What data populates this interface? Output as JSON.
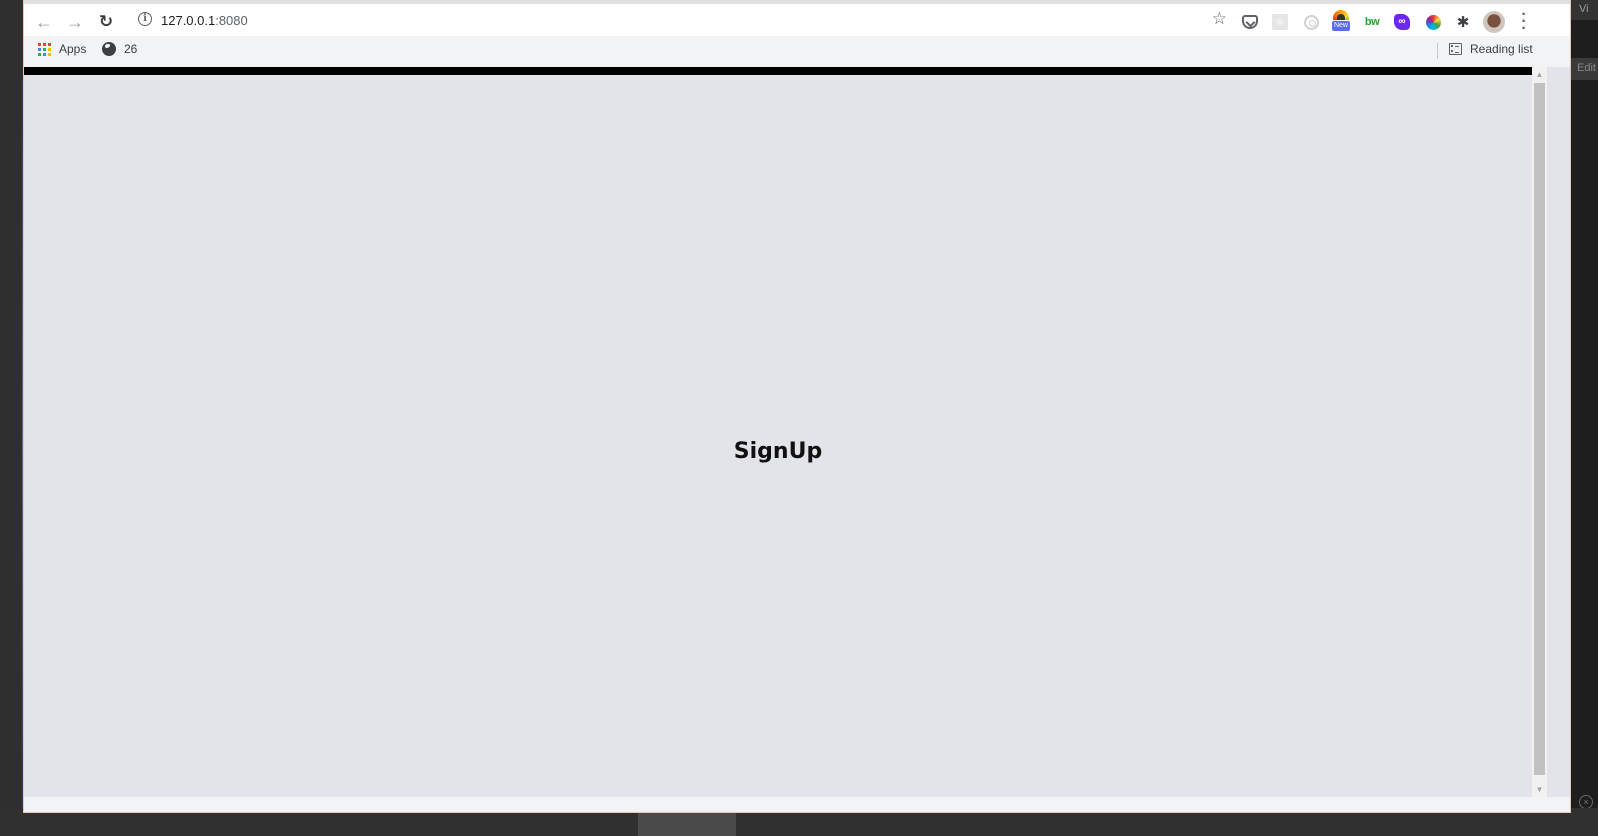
{
  "browser": {
    "url_host": "127.0.0.1",
    "url_port": ":8080",
    "icons": {
      "back": "←",
      "forward": "→",
      "reload": "↻",
      "info": "i",
      "star": "☆",
      "puzzle": "✱",
      "menu": "⋮"
    },
    "extensions": [
      {
        "name": "pocket"
      },
      {
        "name": "react-devtools"
      },
      {
        "name": "target"
      },
      {
        "name": "rainbow",
        "badge": "New"
      },
      {
        "name": "bw",
        "label": "bw"
      },
      {
        "name": "link",
        "label": "∞"
      },
      {
        "name": "color-wheel"
      },
      {
        "name": "extensions-puzzle"
      }
    ]
  },
  "bookmarks": {
    "apps_label": "Apps",
    "apps_colors": [
      "#ea4335",
      "#ea4335",
      "#ea4335",
      "#4285f4",
      "#34a853",
      "#fbbc05",
      "#34a853",
      "#4285f4",
      "#fbbc05"
    ],
    "item_26_label": "26",
    "reading_list_label": "Reading list"
  },
  "page": {
    "title": "SignUp",
    "topbar_color": "#000000",
    "background_color": "#e3e4e9"
  },
  "scrollbar": {
    "up": "▲",
    "down": "▼"
  },
  "desktop": {
    "right_tab_text": "Vi",
    "right_strip_text": "Edit"
  }
}
